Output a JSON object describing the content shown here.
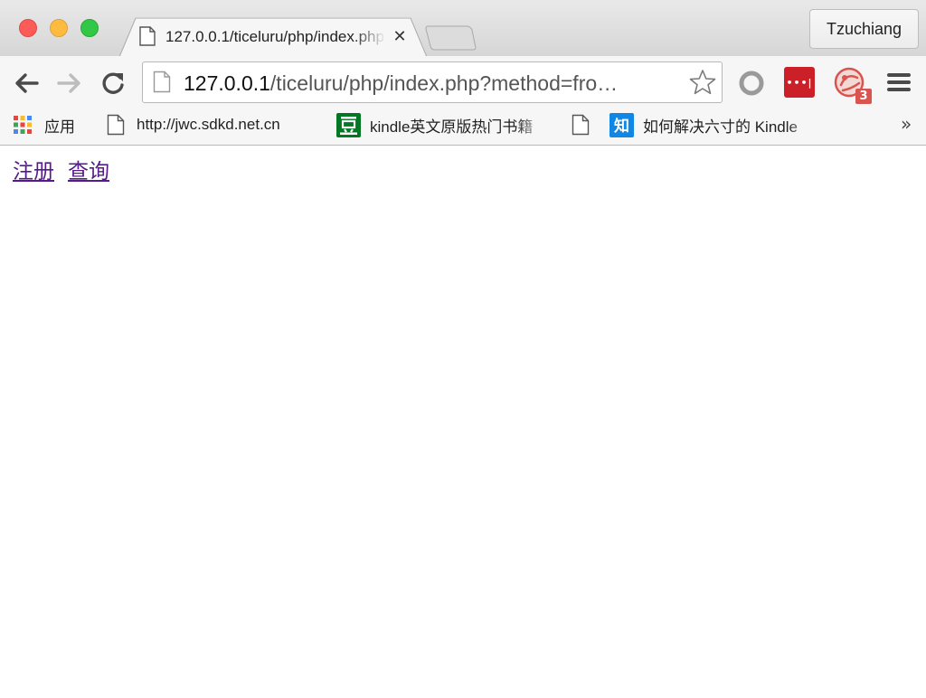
{
  "window": {
    "profile_name": "Tzuchiang"
  },
  "tab": {
    "title": "127.0.0.1/ticeluru/php/index.php",
    "close_glyph": "✕"
  },
  "omnibox": {
    "url_host": "127.0.0.1",
    "url_rest": "/ticeluru/php/index.php?method=fro",
    "url_ellipsis": "…"
  },
  "bookmarks": {
    "apps_label": "应用",
    "items": [
      {
        "label": "http://jwc.sdkd.net.cn",
        "icon": "page-icon"
      },
      {
        "label": "kindle英文原版热门书籍",
        "icon": "douban-icon"
      },
      {
        "label": "",
        "icon": "page-icon"
      },
      {
        "label": "如何解决六寸的 Kindle",
        "icon": "zhihu-icon"
      }
    ],
    "overflow_glyph": "»"
  },
  "extensions": {
    "lastpass_dots": "•••|",
    "badge_count": "3"
  },
  "page": {
    "links": [
      "注册",
      "查询"
    ]
  },
  "colors": {
    "visited_link": "#551a8b",
    "lastpass_red": "#cc2029",
    "zhihu_blue": "#0e87e6",
    "douban_green": "#007722"
  }
}
